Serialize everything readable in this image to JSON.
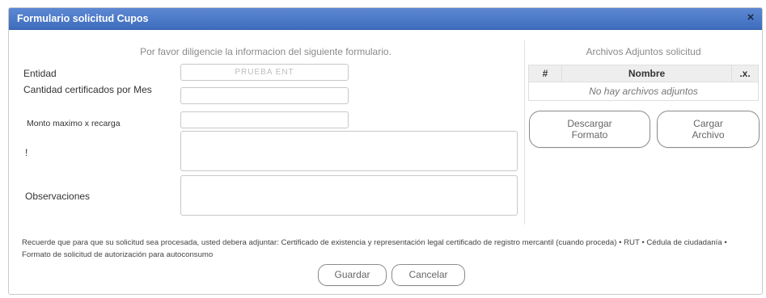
{
  "dialog": {
    "title": "Formulario solicitud Cupos",
    "close_symbol": "×"
  },
  "form": {
    "intro": "Por favor diligencie la informacion del siguiente formulario.",
    "entidad_label": "Entidad",
    "entidad_value": "PRUEBA ENT",
    "cantidad_label": "Cantidad certificados por Mes",
    "cantidad_value": "",
    "monto_label": "Monto maximo x recarga",
    "monto_value": "",
    "extra_label": "!",
    "extra_value": "",
    "observaciones_label": "Observaciones",
    "observaciones_value": ""
  },
  "attachments": {
    "title": "Archivos Adjuntos solicitud",
    "columns": [
      "#",
      "Nombre",
      ".x."
    ],
    "empty_message": "No hay archivos adjuntos",
    "download_button": "Descargar Formato",
    "upload_button": "Cargar Archivo"
  },
  "notice": "Recuerde que para que su solicitud sea procesada, usted debera adjuntar: Certificado de existencia y representación legal certificado de registro mercantil (cuando proceda) • RUT • Cédula de ciudadanía • Formato de solicitud de autorización para autoconsumo",
  "actions": {
    "save": "Guardar",
    "cancel": "Cancelar"
  }
}
